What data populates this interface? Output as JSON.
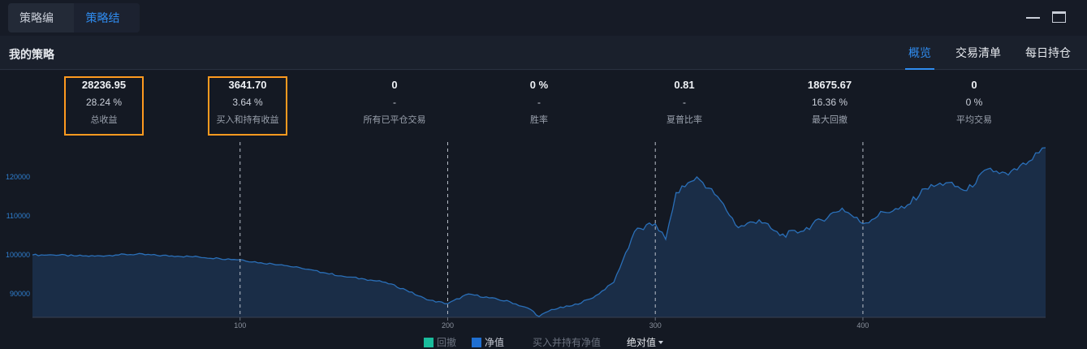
{
  "topbar": {
    "tabs": [
      {
        "label": "策略编写",
        "active": false
      },
      {
        "label": "策略结果",
        "active": true
      }
    ]
  },
  "header": {
    "title": "我的策略",
    "tabs": [
      {
        "label": "概览",
        "active": true
      },
      {
        "label": "交易清单",
        "active": false
      },
      {
        "label": "每日持仓",
        "active": false
      }
    ]
  },
  "stats": [
    {
      "value": "28236.95",
      "percent": "28.24 %",
      "label": "总收益",
      "highlighted": true
    },
    {
      "value": "3641.70",
      "percent": "3.64 %",
      "label": "买入和持有收益",
      "highlighted": true
    },
    {
      "value": "0",
      "percent": "-",
      "label": "所有已平仓交易",
      "highlighted": false
    },
    {
      "value": "0 %",
      "percent": "-",
      "label": "胜率",
      "highlighted": false
    },
    {
      "value": "0.81",
      "percent": "-",
      "label": "夏普比率",
      "highlighted": false
    },
    {
      "value": "18675.67",
      "percent": "16.36 %",
      "label": "最大回撤",
      "highlighted": false
    },
    {
      "value": "0",
      "percent": "0 %",
      "label": "平均交易",
      "highlighted": false
    }
  ],
  "legend": {
    "drawdown": "回撤",
    "net_value": "净值",
    "buy_hold_net": "买入并持有净值",
    "mode": "绝对值"
  },
  "colors": {
    "accent": "#2f8cf0",
    "highlight": "#ff9a1f",
    "drawdown": "#1abc9c",
    "net_value": "#1f6fd1",
    "area_fill": "#1a2d47",
    "line": "#2a6fb8"
  },
  "chart_data": {
    "type": "area",
    "series": [
      {
        "name": "净值",
        "x": [
          0,
          10,
          20,
          30,
          40,
          50,
          60,
          70,
          80,
          90,
          100,
          110,
          120,
          130,
          140,
          150,
          160,
          170,
          180,
          190,
          200,
          210,
          220,
          230,
          240,
          244,
          250,
          260,
          270,
          280,
          290,
          300,
          305,
          310,
          320,
          330,
          340,
          350,
          360,
          370,
          380,
          390,
          400,
          410,
          420,
          430,
          440,
          450,
          460,
          470,
          480,
          488
        ],
        "values": [
          100000,
          100000,
          99800,
          99700,
          100000,
          100200,
          99900,
          99700,
          99500,
          99100,
          98800,
          98000,
          97500,
          96500,
          95500,
          94500,
          93800,
          93000,
          91000,
          88500,
          87500,
          90000,
          89000,
          88000,
          86000,
          84200,
          86000,
          87000,
          89000,
          93000,
          106000,
          108000,
          104000,
          116000,
          120000,
          115000,
          107000,
          109000,
          105000,
          106000,
          109000,
          112000,
          108000,
          111000,
          112000,
          117000,
          118500,
          116500,
          122000,
          120500,
          124000,
          127500
        ]
      }
    ],
    "xlim": [
      0,
      488
    ],
    "ylim": [
      84000,
      130000
    ],
    "x_ticks": [
      100,
      200,
      300,
      400
    ],
    "y_ticks": [
      90000,
      100000,
      110000,
      120000
    ],
    "vlines": [
      100,
      200,
      300,
      400
    ],
    "grid": false,
    "legend_position": "bottom-center"
  }
}
